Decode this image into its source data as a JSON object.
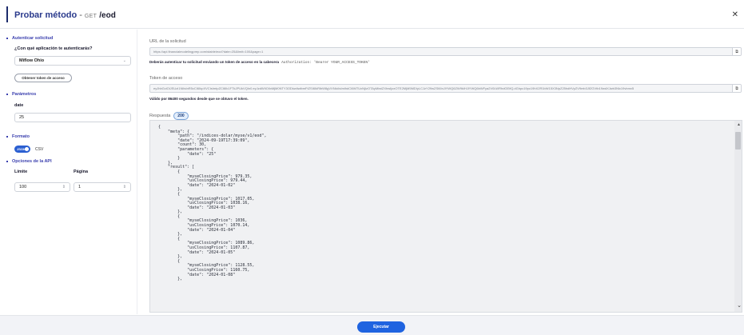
{
  "header": {
    "title": "Probar método",
    "dash": "-",
    "method": "GET",
    "path": "/eod",
    "close_icon": "close-icon"
  },
  "sidebar": {
    "auth_section": "Autenticar solicitud",
    "app_question": "¿Con qué aplicación te autenticarás?",
    "app_selected": "Miflow Ohio",
    "token_button": "Obtener token de acceso",
    "params_section": "Parámetros",
    "date_label": "date",
    "date_value": "25",
    "format_section": "Formato",
    "format_json": "JSON",
    "format_csv": "CSV",
    "api_section": "Opciones de la API",
    "limit_label": "Límite",
    "limit_value": "100",
    "page_label": "Página",
    "page_value": "1"
  },
  "main": {
    "request_url_label": "URL de la solicitud",
    "request_url_value": "https://api.financialmodelingprep.com/stable/eod?date=25&limit=100&page=1",
    "auth_hint": "Deberás autenticar tu solicitud enviando un token de acceso en la cabecera",
    "auth_hint_code": "Authorization: 'Bearer YOUR_ACCESS_TOKEN'",
    "token_label": "Token de acceso",
    "token_value": "eyJhbGciOiJSUzI1NiIsInR5cCI6IkpXVCIsImtpZCI6Ik1FTkJPUkVQIn0.eyJzdWIiOiIxMjM0NTY3ODkwIiwibmFtZSI6IkRlbW8gVXNlciIsImlhdCI6MTUxNjIzOTAyMiwiZXhwIjoxOTE2MjM5MDIyLCJzY29wZSI6InJlYWQ6ZW9kIHJlYWQ6bWFya2V0LWRhdGEifQ.dGhpc19pc19hX2R1bW15X3NpZ25hdHVyZV9mb3JfZGVtb19wdXJwb3Nlc19vbmx5",
    "token_hint": "Válido por 86400 segundos desde que se obtuvo el token.",
    "response_label": "Respuesta",
    "status_code": "200",
    "response_body": "{\n    \"meta\": {\n        \"path\": \"/indices-dolar/myse/v1/eod\",\n        \"date\": \"2024-09-19T17:39:09\",\n        \"count\": 30,\n        \"parameters\": {\n            \"date\": \"25\"\n        }\n    },\n    \"result\": [\n        {\n            \"myseClosingPrice\": 979.35,\n            \"usClosingPrice\": 979.44,\n            \"date\": \"2024-01-02\"\n        },\n        {\n            \"myseClosingPrice\": 1017.05,\n            \"usClosingPrice\": 1038.16,\n            \"date\": \"2024-01-03\"\n        },\n        {\n            \"myseClosingPrice\": 1036,\n            \"usClosingPrice\": 1070.14,\n            \"date\": \"2024-01-04\"\n        },\n        {\n            \"myseClosingPrice\": 1089.86,\n            \"usClosingPrice\": 1107.87,\n            \"date\": \"2024-01-05\"\n        },\n        {\n            \"myseClosingPrice\": 1128.55,\n            \"usClosingPrice\": 1160.75,\n            \"date\": \"2024-01-08\"\n        },"
  },
  "footer": {
    "execute_label": "Ejecutar"
  },
  "colors": {
    "accent": "#1f63e0",
    "section": "#3a3fae",
    "title": "#2a3a8c"
  }
}
